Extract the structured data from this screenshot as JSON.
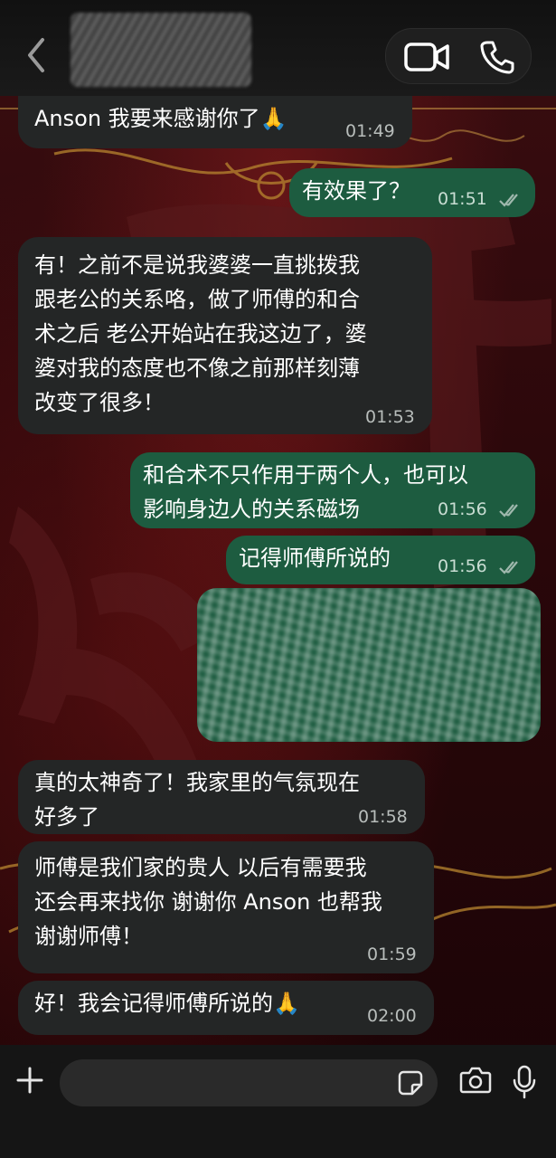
{
  "colors": {
    "incoming_bubble": "#242626",
    "outgoing_bubble": "#1d5c40",
    "read_ticks": "#9fb8ad"
  },
  "header": {
    "icons": [
      "back-arrow-icon",
      "video-call-icon",
      "phone-call-icon"
    ]
  },
  "messages": [
    {
      "dir": "in",
      "lines": [
        "Anson 我要来感谢你了🙏"
      ],
      "time": "01:49"
    },
    {
      "dir": "out",
      "lines": [
        "有效果了？"
      ],
      "time": "01:51",
      "read": true
    },
    {
      "dir": "in",
      "lines": [
        "有！之前不是说我婆婆一直挑拨我",
        "跟老公的关系咯，做了师傅的和合",
        "术之后 老公开始站在我这边了，婆",
        "婆对我的态度也不像之前那样刻薄",
        "改变了很多！"
      ],
      "time": "01:53"
    },
    {
      "dir": "out",
      "lines": [
        "和合术不只作用于两个人，也可以",
        "影响身边人的关系磁场"
      ],
      "time": "01:56",
      "read": true
    },
    {
      "dir": "out",
      "lines": [
        "记得师傅所说的"
      ],
      "time": "01:56",
      "read": true
    },
    {
      "dir": "in",
      "lines": [
        "真的太神奇了！我家里的气氛现在",
        "好多了"
      ],
      "time": "01:58"
    },
    {
      "dir": "in",
      "lines": [
        "师傅是我们家的贵人 以后有需要我",
        "还会再来找你 谢谢你 Anson 也帮我",
        "谢谢师傅！"
      ],
      "time": "01:59"
    },
    {
      "dir": "in",
      "lines": [
        "好！我会记得师傅所说的🙏"
      ],
      "time": "02:00"
    }
  ],
  "input_bar": {
    "placeholder": "",
    "icons": [
      "plus-icon",
      "sticker-icon",
      "camera-icon",
      "microphone-icon"
    ]
  }
}
